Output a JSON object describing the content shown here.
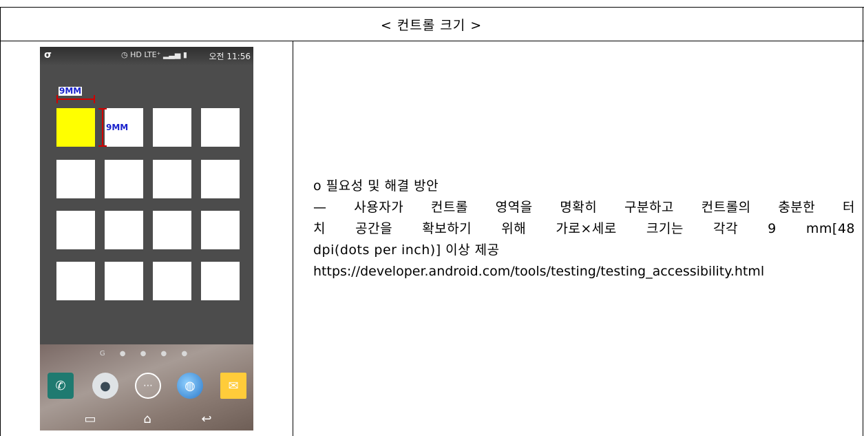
{
  "header": {
    "title": "< 컨트롤 크기 >"
  },
  "phone": {
    "status": {
      "carrier": "σ",
      "network": "HD LTE⁺",
      "time": "오전 11:56"
    },
    "annotations": {
      "width_label": "9MM",
      "height_label": "9MM"
    },
    "grid": {
      "rows": 4,
      "cols": 4,
      "highlighted": [
        0,
        0
      ]
    },
    "page_indicator": "G ● ● ● ●",
    "dock_icons": [
      "phone-icon",
      "contacts-icon",
      "apps-icon",
      "browser-icon",
      "email-icon"
    ],
    "nav": {
      "recent": "▭",
      "home": "⌂",
      "back": "↩"
    }
  },
  "content": {
    "heading": "o 필요성 및 해결 방안",
    "line1": "— 사용자가 컨트롤 영역을 명확히 구분하고 컨트롤의 충분한 터",
    "line2": "치 공간을 확보하기 위해 가로×세로 크기는 각각 9 mm[48",
    "line3": "dpi(dots per inch)] 이상 제공",
    "url": "https://developer.android.com/tools/testing/testing_accessibility.html"
  }
}
